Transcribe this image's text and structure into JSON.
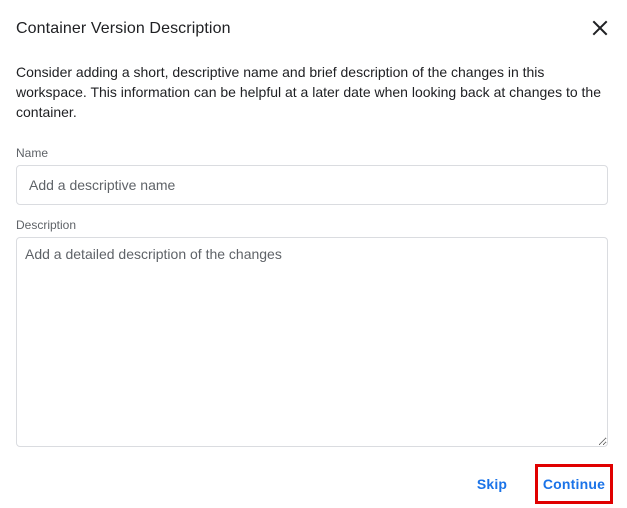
{
  "dialog": {
    "title": "Container Version Description",
    "close_icon": "close-icon",
    "intro": "Consider adding a short, descriptive name and brief description of the changes in this workspace. This information can be helpful at a later date when looking back at changes to the container."
  },
  "form": {
    "name_label": "Name",
    "name_value": "",
    "name_placeholder": "Add a descriptive name",
    "description_label": "Description",
    "description_value": "",
    "description_placeholder": "Add a detailed description of the changes"
  },
  "actions": {
    "skip_label": "Skip",
    "continue_label": "Continue"
  },
  "colors": {
    "accent": "#1a73e8",
    "highlight_border": "#e00000",
    "text": "#202124",
    "muted": "#5f6368"
  }
}
